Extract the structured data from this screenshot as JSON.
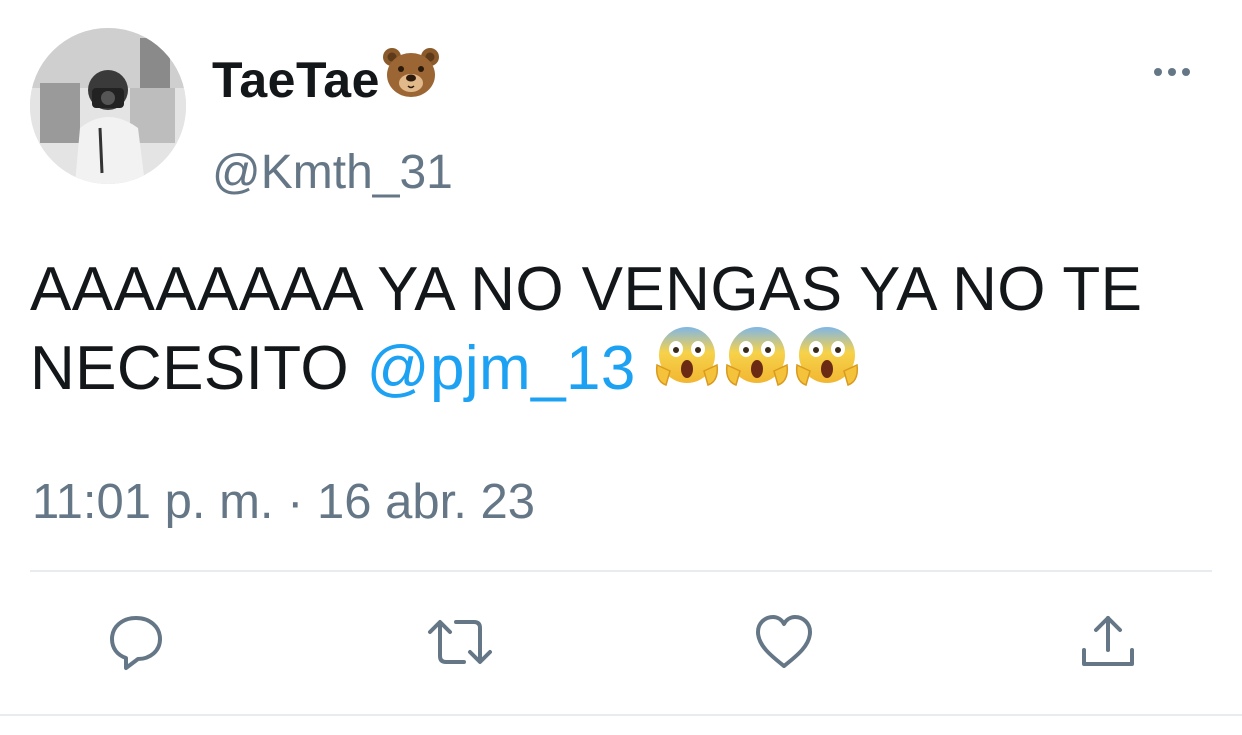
{
  "tweet": {
    "display_name": "TaeTae",
    "handle": "@Kmth_31",
    "text_before_mention": "AAAAAAAA YA NO VENGAS YA NO TE NECESITO ",
    "mention": "@pjm_13",
    "timestamp": "11:01 p. m. · 16 abr. 23"
  },
  "icons": {
    "name_emoji": "bear-face-icon",
    "text_emojis": [
      "screaming-face-icon",
      "screaming-face-icon",
      "screaming-face-icon"
    ],
    "more": "more-dots-icon",
    "actions": [
      "reply-icon",
      "retweet-icon",
      "like-icon",
      "share-icon"
    ]
  },
  "colors": {
    "text": "#14171a",
    "secondary": "#657786",
    "link": "#1da1f2",
    "divider": "#e6ecf0"
  }
}
